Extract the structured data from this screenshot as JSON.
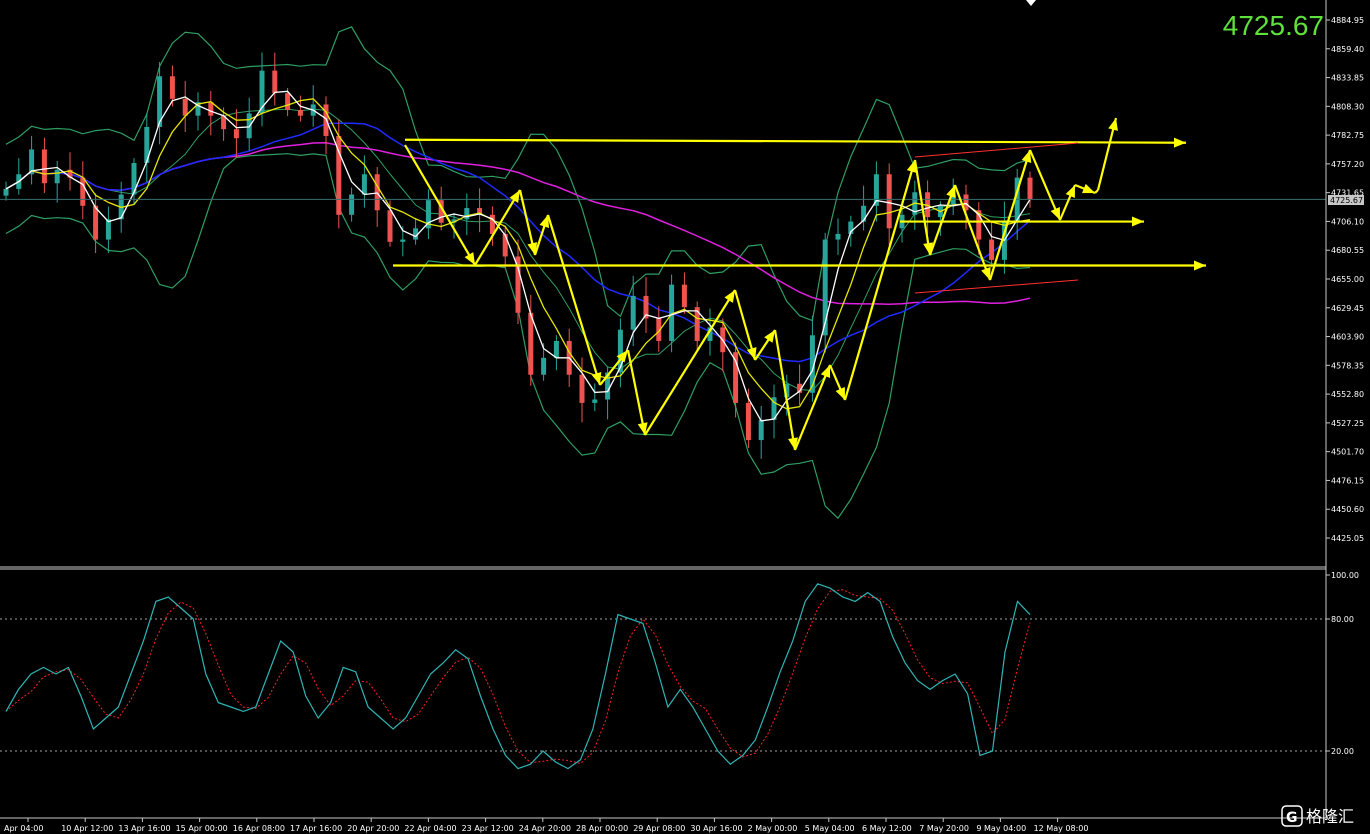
{
  "current_price": "4725.67",
  "price_tag": "4725.67",
  "watermark": {
    "logo_letter": "G",
    "text": "格隆汇"
  },
  "colors": {
    "background": "#000000",
    "bull": "#26a69a",
    "bear": "#ef5350",
    "bollinger": "#2e9e63",
    "ma_white": "#ffffff",
    "ma_yellow": "#e6e600",
    "ma_blue": "#1f2bff",
    "ma_magenta": "#e020e0",
    "drawing": "#ffff00",
    "stoch_main": "#2fb5b5",
    "stoch_signal": "#ff2020",
    "big_price": "#5fe03a"
  },
  "chart_data": [
    {
      "type": "candlestick",
      "ylim": [
        4400,
        4900
      ],
      "price_axis_ticks": [
        "4884.95",
        "4859.40",
        "4833.85",
        "4808.30",
        "4782.75",
        "4757.20",
        "4731.65",
        "4706.10",
        "4680.55",
        "4655.00",
        "4629.45",
        "4603.90",
        "4578.35",
        "4552.80",
        "4527.25",
        "4501.70",
        "4476.15",
        "4450.60",
        "4425.05"
      ],
      "time_axis_labels": [
        "Apr 04:00",
        "10 Apr 12:00",
        "13 Apr 16:00",
        "15 Apr 00:00",
        "16 Apr 08:00",
        "17 Apr 16:00",
        "20 Apr 20:00",
        "22 Apr 04:00",
        "23 Apr 12:00",
        "24 Apr 20:00",
        "28 Apr 00:00",
        "29 Apr 08:00",
        "30 Apr 16:00",
        "2 May 00:00",
        "5 May 04:00",
        "6 May 12:00",
        "7 May 20:00",
        "9 May 04:00",
        "12 May 08:00"
      ],
      "close_path": [
        4735,
        4748,
        4770,
        4740,
        4752,
        4745,
        4720,
        4690,
        4708,
        4730,
        4758,
        4790,
        4835,
        4815,
        4800,
        4812,
        4800,
        4788,
        4780,
        4802,
        4840,
        4820,
        4805,
        4800,
        4810,
        4782,
        4712,
        4730,
        4748,
        4716,
        4688,
        4690,
        4700,
        4725,
        4705,
        4708,
        4718,
        4712,
        4695,
        4675,
        4625,
        4570,
        4585,
        4600,
        4570,
        4545,
        4548,
        4572,
        4610,
        4640,
        4620,
        4600,
        4650,
        4630,
        4600,
        4612,
        4590,
        4545,
        4512,
        4530,
        4550,
        4562,
        4554,
        4605,
        4690,
        4695,
        4706,
        4720,
        4748,
        4700,
        4712,
        4732,
        4710,
        4720,
        4730,
        4716,
        4690,
        4672,
        4706,
        4745,
        4725.67
      ],
      "indicators": [
        "Bollinger Bands",
        "MA white (fast)",
        "MA yellow",
        "MA blue",
        "MA magenta (slow)"
      ],
      "support_resistance_levels": [
        4776,
        4706,
        4667
      ],
      "projection_path": [
        4776,
        4710,
        4745,
        4738,
        4800
      ]
    },
    {
      "type": "line",
      "name": "Stochastic Oscillator",
      "ylim": [
        0,
        100
      ],
      "axis_ticks": [
        "100.00",
        "80.00",
        "20.00"
      ],
      "levels": [
        80,
        20
      ],
      "main": [
        38,
        48,
        55,
        58,
        55,
        58,
        45,
        30,
        35,
        40,
        55,
        70,
        88,
        90,
        85,
        80,
        55,
        42,
        40,
        38,
        40,
        55,
        70,
        65,
        45,
        35,
        42,
        58,
        56,
        40,
        35,
        30,
        35,
        45,
        55,
        60,
        66,
        62,
        45,
        30,
        18,
        12,
        14,
        20,
        15,
        12,
        16,
        30,
        55,
        82,
        80,
        78,
        60,
        40,
        48,
        40,
        30,
        20,
        14,
        18,
        25,
        40,
        56,
        70,
        88,
        96,
        94,
        90,
        88,
        92,
        88,
        72,
        60,
        52,
        48,
        52,
        55,
        46,
        18,
        20,
        65,
        88,
        82
      ]
    }
  ]
}
